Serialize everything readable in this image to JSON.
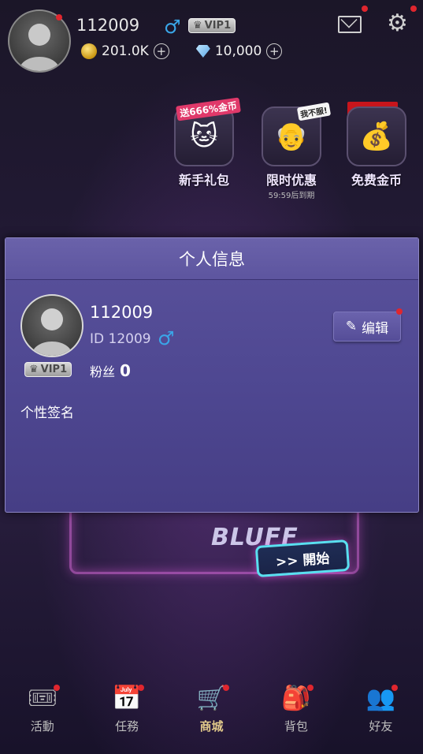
{
  "header": {
    "username": "112009",
    "gender_icon": "male-icon",
    "vip": "VIP1",
    "coins": "201.0K",
    "diamonds": "10,000"
  },
  "promos": [
    {
      "label": "新手礼包",
      "tag": "送666%金币",
      "sub": ""
    },
    {
      "label": "限时优惠",
      "tag": "我不服!",
      "sub": "59:59后到期"
    },
    {
      "label": "免费金币",
      "tag": "",
      "sub": ""
    }
  ],
  "background": {
    "neon_text": "BLUFF",
    "start_button": ">> 開始"
  },
  "dialog": {
    "title": "个人信息",
    "name": "112009",
    "id_text": "ID 12009",
    "vip": "VIP1",
    "fans_label": "粉丝",
    "fans_count": "0",
    "edit_label": "编辑",
    "signature_label": "个性签名"
  },
  "nav": [
    {
      "label": "活動",
      "icon": "ticket-star-icon"
    },
    {
      "label": "任務",
      "icon": "calendar-check-icon"
    },
    {
      "label": "商城",
      "icon": "shopping-cart-icon",
      "active": true
    },
    {
      "label": "背包",
      "icon": "backpack-icon"
    },
    {
      "label": "好友",
      "icon": "friends-icon"
    }
  ],
  "colors": {
    "accent_male": "#3aa6e8",
    "dialog_bg": "#5a529c",
    "notification": "#e0262e",
    "nav_active": "#e0c88a"
  }
}
